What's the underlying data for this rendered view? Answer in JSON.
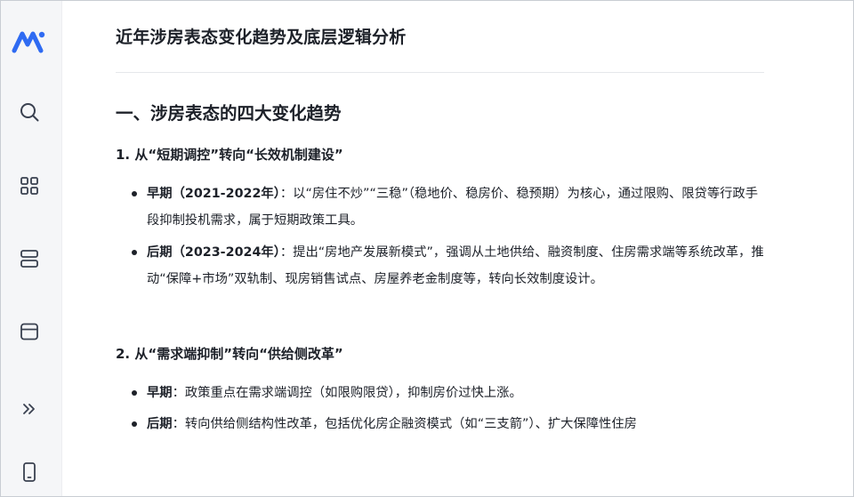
{
  "sidebar": {
    "logo_icon": "brand-logo-icon",
    "buttons": [
      {
        "name": "search-icon"
      },
      {
        "name": "grid-icon"
      },
      {
        "name": "stack-icon"
      },
      {
        "name": "window-icon"
      },
      {
        "name": "chevrons-right-icon"
      },
      {
        "name": "mobile-icon"
      }
    ],
    "accent_color": "#2f6bf2"
  },
  "document": {
    "title": "近年涉房表态变化趋势及底层逻辑分析",
    "section1": {
      "heading": "一、涉房表态的四大变化趋势",
      "sub1": {
        "heading": "1. 从“短期调控”转向“长效机制建设”",
        "items": [
          {
            "label": "早期（2021-2022年）",
            "text": "：以“房住不炒”“三稳”（稳地价、稳房价、稳预期）为核心，通过限购、限贷等行政手段抑制投机需求，属于短期政策工具。"
          },
          {
            "label": "后期（2023-2024年）",
            "text": "：提出“房地产发展新模式”，强调从土地供给、融资制度、住房需求端等系统改革，推动“保障+市场”双轨制、现房销售试点、房屋养老金制度等，转向长效制度设计。"
          }
        ]
      },
      "sub2": {
        "heading": "2. 从“需求端抑制”转向“供给侧改革”",
        "items": [
          {
            "label": "早期",
            "text": "：政策重点在需求端调控（如限购限贷），抑制房价过快上涨。"
          },
          {
            "label": "后期",
            "text": "：转向供给侧结构性改革，包括优化房企融资模式（如“三支箭”）、扩大保障性住房"
          }
        ]
      }
    }
  }
}
